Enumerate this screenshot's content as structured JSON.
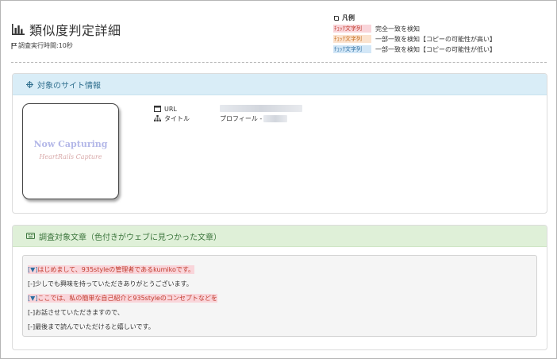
{
  "header": {
    "title": "類似度判定詳細",
    "exec_time": "調査実行時間:10秒"
  },
  "legend": {
    "title": "凡例",
    "items": [
      {
        "sample": "ﾁｪｯｸ文字列",
        "desc": "完全一致を検知",
        "color": "#f9d5da"
      },
      {
        "sample": "ﾁｪｯｸ文字列",
        "desc": "一部一致を検知【コピーの可能性が高い】",
        "color": "#fbe3cf"
      },
      {
        "sample": "ﾁｪｯｸ文字列",
        "desc": "一部一致を検知【コピーの可能性が低い】",
        "color": "#d3e7f7"
      }
    ]
  },
  "site_panel": {
    "heading": "対象のサイト情報",
    "thumbnail": {
      "main": "Now Capturing",
      "sub": "HeartRails Capture"
    },
    "rows": [
      {
        "label": "URL",
        "value": ""
      },
      {
        "label": "タイトル",
        "value": "プロフィール -"
      }
    ]
  },
  "article_panel": {
    "heading": "調査対象文章（色付きがウェブに見つかった文章）",
    "lines": [
      {
        "marker": "[▼]",
        "text": "はじめまして、935styleの管理者であるkumikoです。",
        "highlight": true
      },
      {
        "marker": "[-]",
        "text": "少しでも興味を持っていただきありがとうございます。",
        "highlight": false
      },
      {
        "marker": "[▼]",
        "text": "ここでは、私の簡単な自己紹介と935styleのコンセプトなどを",
        "highlight": true
      },
      {
        "marker": "[-]",
        "text": "お話させていただきますので、",
        "highlight": false
      },
      {
        "marker": "[-]",
        "text": "最後まで読んでいただけると嬉しいです。",
        "highlight": false
      }
    ]
  },
  "colors": {
    "info_head_bg": "#d9edf7",
    "info_head_text": "#31708f",
    "article_head_bg": "#dff0d8",
    "article_head_text": "#3c763d",
    "match_bg": "#f9d5da",
    "match_text": "#c0392b"
  }
}
